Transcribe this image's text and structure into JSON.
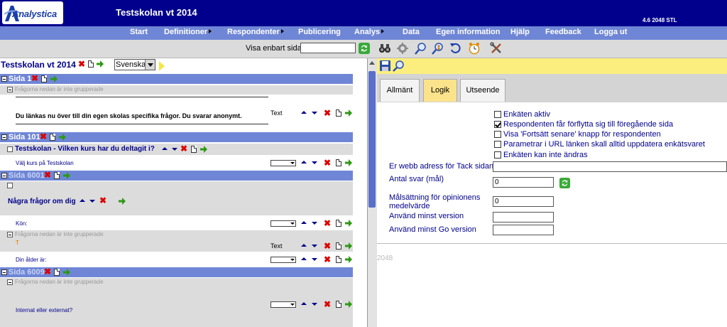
{
  "app": {
    "logo_text": "Analystica",
    "title": "Testskolan vt 2014",
    "version": "4.6 2048 STL"
  },
  "menu": [
    {
      "label": "Start",
      "submenu": false
    },
    {
      "label": "Definitioner",
      "submenu": true
    },
    {
      "label": "Respondenter",
      "submenu": true
    },
    {
      "label": "Publicering",
      "submenu": false
    },
    {
      "label": "Analys",
      "submenu": true
    },
    {
      "label": "Data",
      "submenu": false
    },
    {
      "label": "Egen information",
      "submenu": false
    },
    {
      "label": "Hjälp",
      "submenu": false
    },
    {
      "label": "Feedback",
      "submenu": false
    },
    {
      "label": "Logga ut",
      "submenu": false
    }
  ],
  "toolbar": {
    "visa_label": "Visa enbart sida",
    "visa_value": "",
    "icons": [
      "refresh-icon",
      "binoculars-icon",
      "settings-icon",
      "zoom-icon",
      "zoom-person-icon",
      "undo-icon",
      "alarm-clock-icon",
      "tools-icon"
    ]
  },
  "left": {
    "survey_title": "Testskolan vt 2014",
    "language": "Svenska",
    "pages": {
      "p1": "Sida 1",
      "p101": "Sida 101",
      "p6001": "Sida 6001",
      "p6009": "Sida 6009"
    },
    "group_text": "Frågorna nedan är inte grupperade",
    "intro_text": "Du länkas nu över till din egen skolas specifika frågor. Du svarar anonymt.",
    "type_text": "Text",
    "q101_title": "Testskolan - Vilken kurs har du deltagit i?",
    "q101_item": "Välj kurs på Testskolan",
    "q6001_title": "Några frågor om dig",
    "q_kon": "Kön:",
    "q_t": "T",
    "q_alder": "Din ålder är:",
    "q_internat": "Internat eller externat?"
  },
  "right": {
    "icons": [
      "save-icon",
      "search-icon"
    ],
    "tabs": [
      "Allmänt",
      "Logik",
      "Utseende"
    ],
    "active_tab": "Logik",
    "checkboxes": [
      {
        "label": "Enkäten aktiv",
        "checked": false
      },
      {
        "label": "Respondenten får förflytta sig till föregående sida",
        "checked": true
      },
      {
        "label": "Visa 'Fortsätt senare' knapp för respondenten",
        "checked": false
      },
      {
        "label": "Parametrar i URL länken skall alltid uppdatera enkätsvaret",
        "checked": false
      },
      {
        "label": "Enkäten kan inte ändras",
        "checked": false
      }
    ],
    "fields": {
      "tack_label": "Er webb adress för Tack sidan",
      "tack_value": "",
      "antal_label": "Antal svar (mål)",
      "antal_value": "0",
      "malsattning_label_1": "Målsättning för opinionens",
      "malsattning_label_2": "medelvärde",
      "malsattning_value": "0",
      "minst_version_label": "Använd minst version",
      "minst_version_value": "",
      "minst_go_label": "Använd minst Go version",
      "minst_go_value": ""
    },
    "footer": "2048"
  },
  "colors": {
    "header_bg": "#00008c",
    "menu_bg": "#6f86d6",
    "active_tab": "#fbe38c",
    "icon_bar": "#fbee7e"
  }
}
